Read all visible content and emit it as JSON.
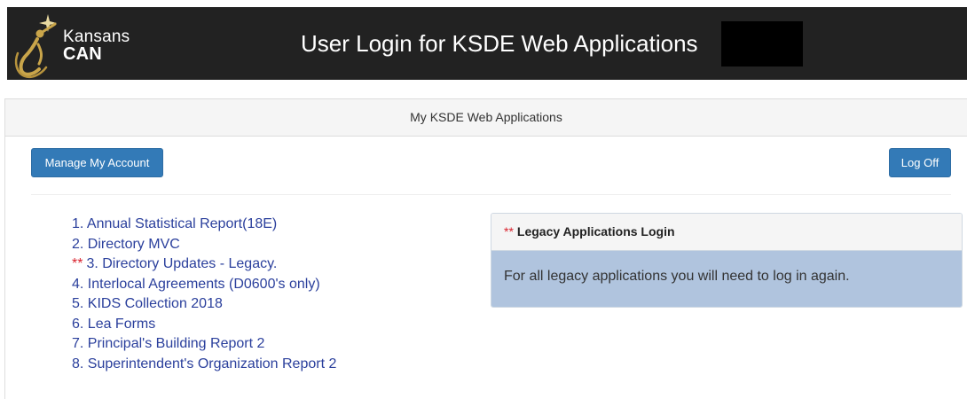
{
  "header": {
    "logo_line1": "Kansans",
    "logo_line2": "CAN",
    "title": "User Login for KSDE Web Applications"
  },
  "panel": {
    "heading": "My KSDE Web Applications",
    "manage_button": "Manage My Account",
    "logoff_button": "Log Off"
  },
  "applications": [
    {
      "label": "1. Annual Statistical Report(18E)",
      "legacy": false
    },
    {
      "label": "2. Directory MVC",
      "legacy": false
    },
    {
      "label": "3. Directory Updates - Legacy.",
      "legacy": true
    },
    {
      "label": "4. Interlocal Agreements (D0600's only)",
      "legacy": false
    },
    {
      "label": "5. KIDS Collection 2018",
      "legacy": false
    },
    {
      "label": "6. Lea Forms",
      "legacy": false
    },
    {
      "label": "7. Principal's Building Report 2",
      "legacy": false
    },
    {
      "label": "8. Superintendent's Organization Report 2",
      "legacy": false
    }
  ],
  "legacy_marker": "**",
  "legacy_panel": {
    "heading": "Legacy Applications Login",
    "body": "For all legacy applications you will need to log in again."
  },
  "colors": {
    "header_bg": "#222222",
    "button_blue": "#337ab7",
    "link_blue": "#2a3f9c",
    "legacy_red": "#d9232e",
    "legacy_body_bg": "#b0c4de",
    "logo_gold": "#c9a54a"
  },
  "icons": {
    "logo": "kansans-can-figure-icon"
  }
}
